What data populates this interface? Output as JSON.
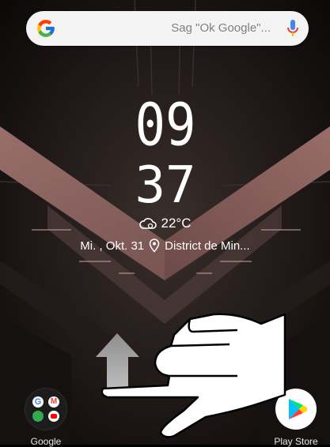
{
  "search": {
    "placeholder": "Sag \"Ok Google\"...",
    "logo_icon": "google-g-icon",
    "mic_icon": "microphone-icon"
  },
  "clock": {
    "hours": "09",
    "minutes": "37"
  },
  "weather": {
    "icon": "cloudy-weather-icon",
    "temperature": "22°C"
  },
  "date": {
    "text": "Mi. , Okt. 31",
    "location_icon": "location-pin-icon",
    "location": "District de Min..."
  },
  "dock": {
    "left_app": {
      "label": "Google",
      "icon": "google-folder-icon"
    },
    "right_app": {
      "label": "Play Store",
      "icon": "play-store-icon"
    }
  },
  "gesture": {
    "arrow": "swipe-up-arrow",
    "hand": "pointing-hand"
  },
  "colors": {
    "search_bg": "#f3f3f3",
    "text_white": "#ffffff",
    "mic_blue": "#4285f4",
    "wallpaper_dark": "#1a1513",
    "wallpaper_pink": "#8a6260"
  }
}
